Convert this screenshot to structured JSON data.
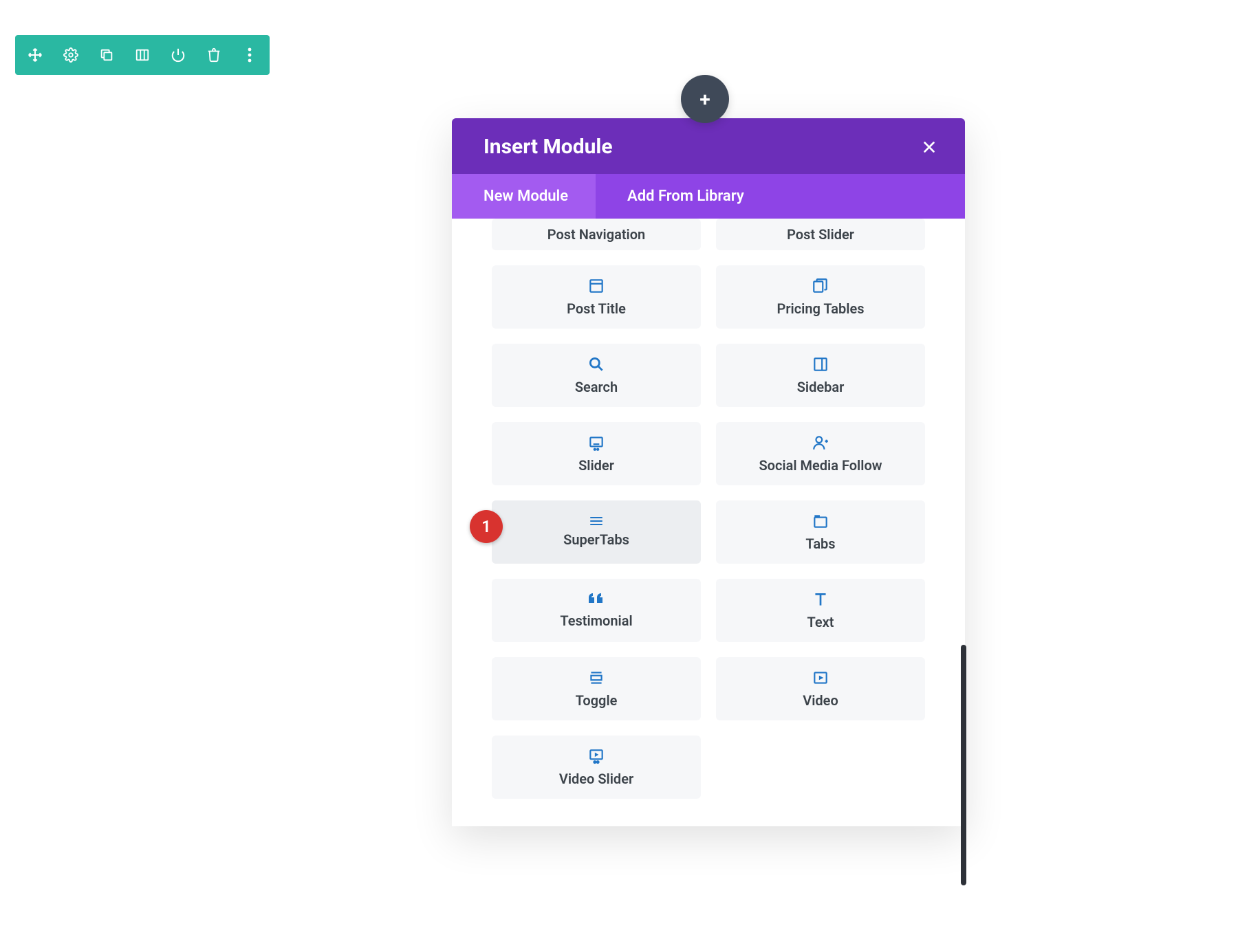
{
  "toolbar": {
    "items": [
      {
        "name": "move-icon"
      },
      {
        "name": "gear-icon"
      },
      {
        "name": "duplicate-icon"
      },
      {
        "name": "columns-icon"
      },
      {
        "name": "power-icon"
      },
      {
        "name": "delete-icon"
      },
      {
        "name": "more-icon"
      }
    ]
  },
  "plus_button_label": "+",
  "modal": {
    "title": "Insert Module",
    "tabs": [
      {
        "label": "New Module",
        "active": true
      },
      {
        "label": "Add From Library",
        "active": false
      }
    ],
    "modules": [
      {
        "label": "Post Navigation",
        "icon": "none",
        "short": true
      },
      {
        "label": "Post Slider",
        "icon": "none",
        "short": true
      },
      {
        "label": "Post Title",
        "icon": "window"
      },
      {
        "label": "Pricing Tables",
        "icon": "tables"
      },
      {
        "label": "Search",
        "icon": "search"
      },
      {
        "label": "Sidebar",
        "icon": "sidebar"
      },
      {
        "label": "Slider",
        "icon": "slider"
      },
      {
        "label": "Social Media Follow",
        "icon": "person-plus"
      },
      {
        "label": "SuperTabs",
        "icon": "bars",
        "hover": true,
        "annotation": "1"
      },
      {
        "label": "Tabs",
        "icon": "tab"
      },
      {
        "label": "Testimonial",
        "icon": "quote"
      },
      {
        "label": "Text",
        "icon": "text"
      },
      {
        "label": "Toggle",
        "icon": "toggle"
      },
      {
        "label": "Video",
        "icon": "video"
      },
      {
        "label": "Video Slider",
        "icon": "video-slider"
      }
    ]
  },
  "colors": {
    "toolbar_bg": "#2ab8a2",
    "modal_header": "#6c2eb9",
    "modal_tabs_bg": "#8e44e6",
    "modal_tab_active": "#a35bf0",
    "card_bg": "#f6f7f9",
    "card_hover_bg": "#eceef1",
    "icon_blue": "#2176c7",
    "badge_red": "#d8332f",
    "plus_handle": "#3f4958"
  }
}
